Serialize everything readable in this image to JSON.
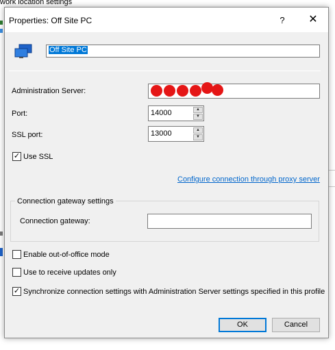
{
  "background": {
    "title_partial": "work location settings"
  },
  "dialog": {
    "title": "Properties: Off Site  PC",
    "help_label": "?",
    "close_label": "✕",
    "profile_name": "Off Site  PC",
    "admin_server_label": "Administration Server:",
    "port_label": "Port:",
    "port_value": "14000",
    "ssl_port_label": "SSL port:",
    "ssl_port_value": "13000",
    "use_ssl_label": "Use SSL",
    "use_ssl_checked": true,
    "proxy_link": "Configure connection through proxy server",
    "gateway_group_label": "Connection gateway settings",
    "gateway_label": "Connection gateway:",
    "gateway_value": "",
    "out_of_office_label": "Enable out-of-office mode",
    "out_of_office_checked": false,
    "updates_label": "Use to receive updates only",
    "updates_checked": false,
    "sync_label": "Synchronize connection settings with Administration Server settings specified in this profile",
    "sync_checked": true,
    "ok_label": "OK",
    "cancel_label": "Cancel"
  },
  "colors": {
    "accent": "#0078d7",
    "link": "#0066cc",
    "redaction": "#e51616",
    "dialog_bg": "#f0f0f0"
  },
  "icons": {
    "profile": "computer-icon",
    "spin_up": "chevron-up-icon",
    "spin_down": "chevron-down-icon",
    "close": "close-icon",
    "help": "help-icon"
  }
}
